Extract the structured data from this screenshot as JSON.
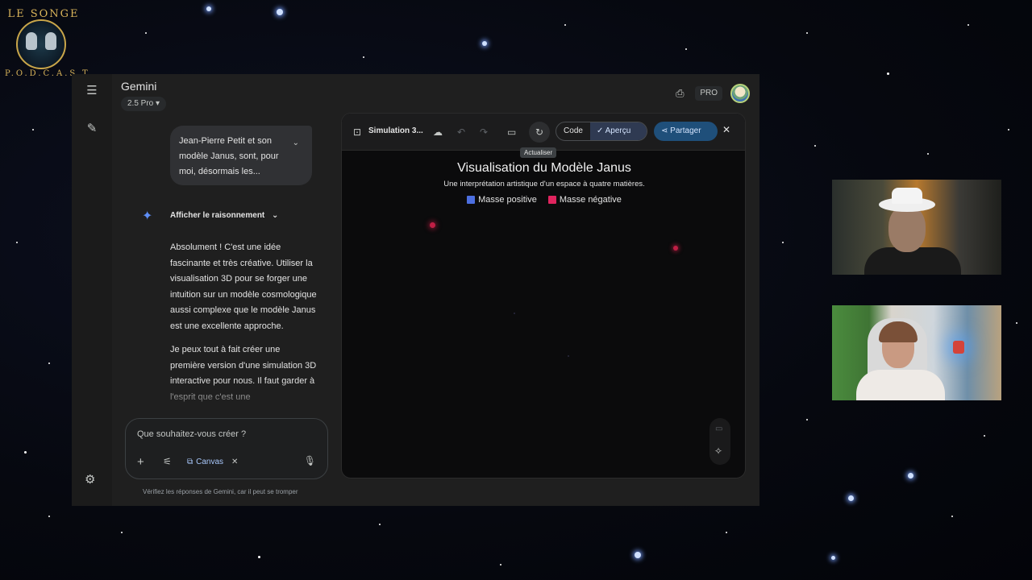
{
  "logo": {
    "top": "LE SONGE",
    "bottom": "P.O.D.C.A.S.T"
  },
  "app": {
    "title": "Gemini",
    "model": "2.5 Pro",
    "pro_badge": "PRO"
  },
  "chat": {
    "user_message": "Jean-Pierre Petit et son modèle Janus, sont, pour moi, désormais les...",
    "reasoning_label": "Afficher le raisonnement",
    "answer_p1": "Absolument ! C'est une idée fascinante et très créative. Utiliser la visualisation 3D pour se forger une intuition sur un modèle cosmologique aussi complexe que le modèle Janus est une excellente approche.",
    "answer_p2": "Je peux tout à fait créer une première version d'une simulation 3D interactive pour nous. Il faut garder à l'esprit que c'est une",
    "input_placeholder": "Que souhaitez-vous créer ?",
    "canvas_chip": "Canvas",
    "disclaimer": "Vérifiez les réponses de Gemini, car il peut se tromper"
  },
  "canvas": {
    "doc_title": "Simulation 3...",
    "tooltip": "Actualiser",
    "code_label": "Code",
    "preview_label": "Aperçu",
    "share_label": "Partager"
  },
  "viz": {
    "title": "Visualisation du Modèle Janus",
    "subtitle": "Une interprétation artistique d'un espace à quatre matières.",
    "legend": [
      {
        "label": "Masse positive",
        "color": "#4c6fe0"
      },
      {
        "label": "Masse négative",
        "color": "#e0245e"
      }
    ]
  },
  "colors": {
    "accent_blue": "#a8c7fa",
    "share_bg": "#1f4f7a",
    "negative_mass": "#e0245e",
    "positive_mass": "#4c6fe0"
  },
  "icons": {
    "menu": "menu-icon",
    "new_chat": "edit-icon",
    "settings": "gear-icon",
    "print": "print-icon",
    "sparkle": "gemini-sparkle-icon",
    "refresh": "refresh-icon",
    "share": "share-icon",
    "close": "close-icon",
    "mic": "mic-icon"
  }
}
